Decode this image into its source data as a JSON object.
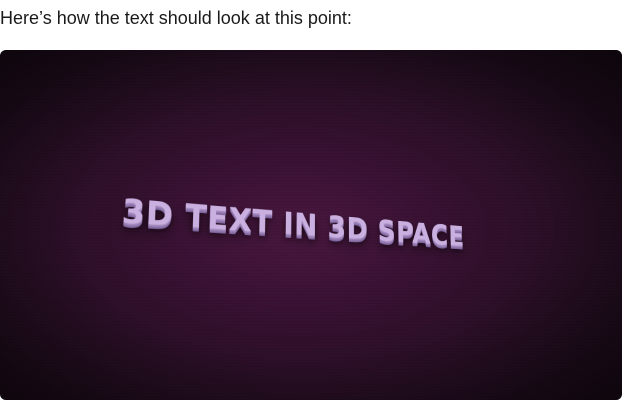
{
  "caption": "Here’s how the text should look at this point:",
  "scene": {
    "text": "3D TEXT IN 3D SPACE",
    "colors": {
      "background_center": "#4a1740",
      "background_edge": "#150913",
      "text_face": "#c9b0e0",
      "text_extrusion": "#7b629a"
    }
  }
}
